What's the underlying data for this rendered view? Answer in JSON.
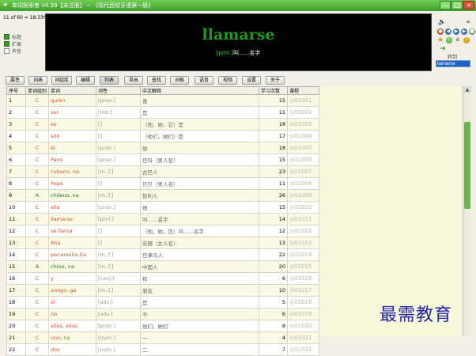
{
  "window": {
    "title": "单词探索者 V4.59【未注册】 -- 《现代西班牙语第一册》",
    "controls": [
      "—",
      "□",
      "✕"
    ]
  },
  "status": {
    "counter": "11 of 60 = 18.33%"
  },
  "options": [
    {
      "label": "标题",
      "checked": true
    },
    {
      "label": "扩展",
      "checked": true
    },
    {
      "label": "声音",
      "checked": false
    }
  ],
  "display": {
    "word": "llamarse",
    "pos": "[prnl.]",
    "meaning": "叫......名字"
  },
  "right_panel": {
    "goto_label": "转到",
    "goto_value": "llamarse"
  },
  "toolbar": {
    "buttons": [
      "属性",
      "词典",
      "词组库",
      "编辑",
      "列表",
      "导出",
      "查找",
      "词根",
      "语音",
      "视频",
      "设置",
      "关于"
    ],
    "active_index": 4
  },
  "table": {
    "headers": [
      "序号",
      "单词组别",
      "单词",
      "词性",
      "中文解释",
      "学习次数",
      "课程"
    ],
    "selected_index": 10,
    "rows": [
      {
        "seq": "1",
        "cls": "C",
        "word": "quién",
        "pos": "[pron.]",
        "meaning": "谁",
        "count": "15",
        "lesson": "01001"
      },
      {
        "seq": "2",
        "cls": "C",
        "word": "ser",
        "pos": "[intr.]",
        "meaning": "是",
        "count": "11",
        "lesson": "01002"
      },
      {
        "seq": "3",
        "cls": "C",
        "word": "es",
        "pos": "[]",
        "meaning": "（他，她，它）是",
        "count": "18",
        "lesson": "01003"
      },
      {
        "seq": "4",
        "cls": "C",
        "word": "son",
        "pos": "[]",
        "meaning": "（他们，她们）是",
        "count": "17",
        "lesson": "01004"
      },
      {
        "seq": "5",
        "cls": "C",
        "word": "él",
        "pos": "[pron.]",
        "meaning": "他",
        "count": "18",
        "lesson": "01005"
      },
      {
        "seq": "6",
        "cls": "C",
        "word": "Paco",
        "pos": "[pron.]",
        "meaning": "巴科（男人名）",
        "count": "15",
        "lesson": "01006"
      },
      {
        "seq": "7",
        "cls": "C",
        "word": "cubano, na",
        "pos": "[m.,f.]",
        "meaning": "古巴人",
        "count": "23",
        "lesson": "01007"
      },
      {
        "seq": "8",
        "cls": "C",
        "word": "Pepe",
        "pos": "[]",
        "meaning": "贝贝（男人名）",
        "count": "11",
        "lesson": "01008"
      },
      {
        "seq": "9",
        "cls": "A",
        "word": "chileno, na",
        "pos": "[m.,f.]",
        "meaning": "智利人",
        "count": "26",
        "lesson": "01009"
      },
      {
        "seq": "10",
        "cls": "C",
        "word": "ella",
        "pos": "[pron.]",
        "meaning": "她",
        "count": "15",
        "lesson": "01010"
      },
      {
        "seq": "11",
        "cls": "C",
        "word": "llamarse",
        "pos": "[prnl.]",
        "meaning": "叫……名字",
        "count": "14",
        "lesson": "01011"
      },
      {
        "seq": "12",
        "cls": "C",
        "word": "se llama",
        "pos": "[]",
        "meaning": "（他，她，您）叫……名字",
        "count": "12",
        "lesson": "01012"
      },
      {
        "seq": "13",
        "cls": "C",
        "word": "Ana",
        "pos": "[]",
        "meaning": "安娜（女人名）",
        "count": "13",
        "lesson": "01013"
      },
      {
        "seq": "14",
        "cls": "C",
        "word": "panameño,ña",
        "pos": "[m.,f.]",
        "meaning": "巴拿马人",
        "count": "22",
        "lesson": "01014"
      },
      {
        "seq": "15",
        "cls": "A",
        "word": "chino, na",
        "pos": "[m.,f.]",
        "meaning": "中国人",
        "count": "20",
        "lesson": "01015"
      },
      {
        "seq": "16",
        "cls": "C",
        "word": "y",
        "pos": "[conj.]",
        "meaning": "和",
        "count": "6",
        "lesson": "01016"
      },
      {
        "seq": "17",
        "cls": "C",
        "word": "amigo, ga",
        "pos": "[m.,f.]",
        "meaning": "朋友",
        "count": "10",
        "lesson": "01017"
      },
      {
        "seq": "18",
        "cls": "C",
        "word": "sí",
        "pos": "[adv.]",
        "meaning": "是",
        "count": "5",
        "lesson": "01018"
      },
      {
        "seq": "19",
        "cls": "C",
        "word": "no",
        "pos": "[adv.]",
        "meaning": "不",
        "count": "6",
        "lesson": "01019"
      },
      {
        "seq": "20",
        "cls": "C",
        "word": "ellos, ellas",
        "pos": "[pron.]",
        "meaning": "他们，她们",
        "count": "8",
        "lesson": "01020"
      },
      {
        "seq": "21",
        "cls": "C",
        "word": "uno, na",
        "pos": "[num.]",
        "meaning": "一",
        "count": "4",
        "lesson": "01021"
      },
      {
        "seq": "22",
        "cls": "C",
        "word": "dos",
        "pos": "[num.]",
        "meaning": "二",
        "count": "7",
        "lesson": "01022"
      }
    ]
  },
  "watermark": "最需教育"
}
